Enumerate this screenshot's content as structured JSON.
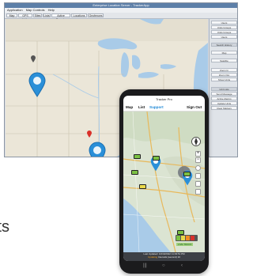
{
  "desktop": {
    "title": "Enterprise Location Server - TrackerApp",
    "menu": [
      "Application",
      "Map Controls",
      "Help"
    ],
    "tabs": [
      "Map",
      "GPS Units",
      "Sites",
      "Lists",
      "Active Reports",
      "Locations",
      "Geofences"
    ],
    "side_buttons": [
      "Users",
      "Units Groups",
      "Units Groups",
      "Users",
      "",
      "Search History",
      "",
      "Map",
      "Satellite",
      "",
      "Zoom In",
      "Zoom Out",
      "Show Units",
      "Refresh",
      "",
      "Unit Lists",
      "Send Message",
      "Active Alarms",
      "Update Units",
      "Clear Markers"
    ]
  },
  "bottom_text": "its",
  "phone": {
    "title": "Tracker Pro",
    "nav": {
      "map": "Map",
      "list": "List",
      "support": "Support",
      "sign_out": "Sign Out"
    },
    "overlay_label": "LIVE TRACK",
    "status_line1": "Last Updated: 10/19/2022 11:03:51 PM",
    "status_highlight": "Updating",
    "status_line2": "Intervals (second) 10",
    "zoom_in": "+",
    "zoom_out": "−"
  },
  "colors": {
    "accent": "#1e88d6",
    "pin": "#2a8fd8",
    "window_title": "#5d7fa8"
  }
}
